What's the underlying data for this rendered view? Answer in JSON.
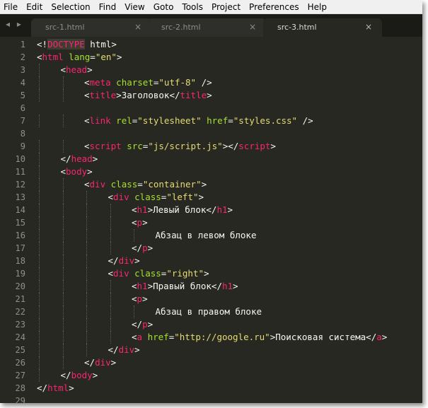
{
  "menu": [
    "File",
    "Edit",
    "Selection",
    "Find",
    "View",
    "Goto",
    "Tools",
    "Project",
    "Preferences",
    "Help"
  ],
  "nav_arrows": "◂ ▸",
  "tabs": [
    {
      "label": "src-1.html",
      "close": "×",
      "active": false
    },
    {
      "label": "src-2.html",
      "close": "×",
      "active": false
    },
    {
      "label": "src-3.html",
      "close": "×",
      "active": true
    }
  ],
  "colors": {
    "background": "#272822",
    "tag": "#f92672",
    "attribute": "#a6e22e",
    "string": "#e6db74",
    "text": "#f8f8f2",
    "line_number": "#8f908a"
  },
  "lines": [
    {
      "n": "1",
      "indent": 0,
      "tokens": [
        [
          "p",
          "<!"
        ],
        [
          "d",
          "DOCTYPE"
        ],
        [
          "p",
          " html>"
        ]
      ]
    },
    {
      "n": "2",
      "indent": 0,
      "tokens": [
        [
          "p",
          "<"
        ],
        [
          "t",
          "html"
        ],
        [
          "p",
          " "
        ],
        [
          "a",
          "lang"
        ],
        [
          "p",
          "="
        ],
        [
          "s",
          "\"en\""
        ],
        [
          "p",
          ">"
        ]
      ]
    },
    {
      "n": "3",
      "indent": 1,
      "tokens": [
        [
          "p",
          "<"
        ],
        [
          "t",
          "head"
        ],
        [
          "p",
          ">"
        ]
      ]
    },
    {
      "n": "4",
      "indent": 2,
      "tokens": [
        [
          "p",
          "<"
        ],
        [
          "t",
          "meta"
        ],
        [
          "p",
          " "
        ],
        [
          "a",
          "charset"
        ],
        [
          "p",
          "="
        ],
        [
          "s",
          "\"utf-8\""
        ],
        [
          "p",
          " />"
        ]
      ]
    },
    {
      "n": "5",
      "indent": 2,
      "tokens": [
        [
          "p",
          "<"
        ],
        [
          "t",
          "title"
        ],
        [
          "p",
          ">"
        ],
        [
          "x",
          "Заголовок"
        ],
        [
          "p",
          "</"
        ],
        [
          "t",
          "title"
        ],
        [
          "p",
          ">"
        ]
      ]
    },
    {
      "n": "6",
      "indent": 0,
      "tokens": []
    },
    {
      "n": "7",
      "indent": 2,
      "tokens": [
        [
          "p",
          "<"
        ],
        [
          "t",
          "link"
        ],
        [
          "p",
          " "
        ],
        [
          "a",
          "rel"
        ],
        [
          "p",
          "="
        ],
        [
          "s",
          "\"stylesheet\""
        ],
        [
          "p",
          " "
        ],
        [
          "a",
          "href"
        ],
        [
          "p",
          "="
        ],
        [
          "s",
          "\"styles.css\""
        ],
        [
          "p",
          " />"
        ]
      ]
    },
    {
      "n": "8",
      "indent": 0,
      "tokens": []
    },
    {
      "n": "9",
      "indent": 2,
      "tokens": [
        [
          "p",
          "<"
        ],
        [
          "t",
          "script"
        ],
        [
          "p",
          " "
        ],
        [
          "a",
          "src"
        ],
        [
          "p",
          "="
        ],
        [
          "s",
          "\"js/script.js\""
        ],
        [
          "p",
          "></"
        ],
        [
          "t",
          "script"
        ],
        [
          "p",
          ">"
        ]
      ]
    },
    {
      "n": "10",
      "indent": 1,
      "tokens": [
        [
          "p",
          "</"
        ],
        [
          "t",
          "head"
        ],
        [
          "p",
          ">"
        ]
      ]
    },
    {
      "n": "11",
      "indent": 1,
      "tokens": [
        [
          "p",
          "<"
        ],
        [
          "t",
          "body"
        ],
        [
          "p",
          ">"
        ]
      ]
    },
    {
      "n": "12",
      "indent": 2,
      "tokens": [
        [
          "p",
          "<"
        ],
        [
          "t",
          "div"
        ],
        [
          "p",
          " "
        ],
        [
          "a",
          "class"
        ],
        [
          "p",
          "="
        ],
        [
          "s",
          "\"container\""
        ],
        [
          "p",
          ">"
        ]
      ]
    },
    {
      "n": "13",
      "indent": 3,
      "tokens": [
        [
          "p",
          "<"
        ],
        [
          "t",
          "div"
        ],
        [
          "p",
          " "
        ],
        [
          "a",
          "class"
        ],
        [
          "p",
          "="
        ],
        [
          "s",
          "\"left\""
        ],
        [
          "p",
          ">"
        ]
      ]
    },
    {
      "n": "14",
      "indent": 4,
      "tokens": [
        [
          "p",
          "<"
        ],
        [
          "t",
          "h1"
        ],
        [
          "p",
          ">"
        ],
        [
          "x",
          "Левый блок"
        ],
        [
          "p",
          "</"
        ],
        [
          "t",
          "h1"
        ],
        [
          "p",
          ">"
        ]
      ]
    },
    {
      "n": "15",
      "indent": 4,
      "tokens": [
        [
          "p",
          "<"
        ],
        [
          "t",
          "p"
        ],
        [
          "p",
          ">"
        ]
      ]
    },
    {
      "n": "16",
      "indent": 5,
      "tokens": [
        [
          "x",
          "Абзац в левом блоке"
        ]
      ]
    },
    {
      "n": "17",
      "indent": 4,
      "tokens": [
        [
          "p",
          "</"
        ],
        [
          "t",
          "p"
        ],
        [
          "p",
          ">"
        ]
      ]
    },
    {
      "n": "18",
      "indent": 3,
      "tokens": [
        [
          "p",
          "</"
        ],
        [
          "t",
          "div"
        ],
        [
          "p",
          ">"
        ]
      ]
    },
    {
      "n": "19",
      "indent": 3,
      "tokens": [
        [
          "p",
          "<"
        ],
        [
          "t",
          "div"
        ],
        [
          "p",
          " "
        ],
        [
          "a",
          "class"
        ],
        [
          "p",
          "="
        ],
        [
          "s",
          "\"right\""
        ],
        [
          "p",
          ">"
        ]
      ]
    },
    {
      "n": "20",
      "indent": 4,
      "tokens": [
        [
          "p",
          "<"
        ],
        [
          "t",
          "h1"
        ],
        [
          "p",
          ">"
        ],
        [
          "x",
          "Правый блок"
        ],
        [
          "p",
          "</"
        ],
        [
          "t",
          "h1"
        ],
        [
          "p",
          ">"
        ]
      ]
    },
    {
      "n": "21",
      "indent": 4,
      "tokens": [
        [
          "p",
          "<"
        ],
        [
          "t",
          "p"
        ],
        [
          "p",
          ">"
        ]
      ]
    },
    {
      "n": "22",
      "indent": 5,
      "tokens": [
        [
          "x",
          "Абзац в правом блоке"
        ]
      ]
    },
    {
      "n": "23",
      "indent": 4,
      "tokens": [
        [
          "p",
          "</"
        ],
        [
          "t",
          "p"
        ],
        [
          "p",
          ">"
        ]
      ]
    },
    {
      "n": "24",
      "indent": 4,
      "tokens": [
        [
          "p",
          "<"
        ],
        [
          "t",
          "a"
        ],
        [
          "p",
          " "
        ],
        [
          "a",
          "href"
        ],
        [
          "p",
          "="
        ],
        [
          "s",
          "\"http://google.ru\""
        ],
        [
          "p",
          ">"
        ],
        [
          "x",
          "Поисковая система"
        ],
        [
          "p",
          "</"
        ],
        [
          "t",
          "a"
        ],
        [
          "p",
          ">"
        ]
      ]
    },
    {
      "n": "25",
      "indent": 3,
      "tokens": [
        [
          "p",
          "</"
        ],
        [
          "t",
          "div"
        ],
        [
          "p",
          ">"
        ]
      ]
    },
    {
      "n": "26",
      "indent": 2,
      "tokens": [
        [
          "p",
          "</"
        ],
        [
          "t",
          "div"
        ],
        [
          "p",
          ">"
        ]
      ]
    },
    {
      "n": "27",
      "indent": 1,
      "tokens": [
        [
          "p",
          "</"
        ],
        [
          "t",
          "body"
        ],
        [
          "p",
          ">"
        ]
      ]
    },
    {
      "n": "28",
      "indent": 0,
      "tokens": [
        [
          "p",
          "</"
        ],
        [
          "t",
          "html"
        ],
        [
          "p",
          ">"
        ]
      ]
    },
    {
      "n": "29",
      "indent": 0,
      "tokens": []
    }
  ]
}
